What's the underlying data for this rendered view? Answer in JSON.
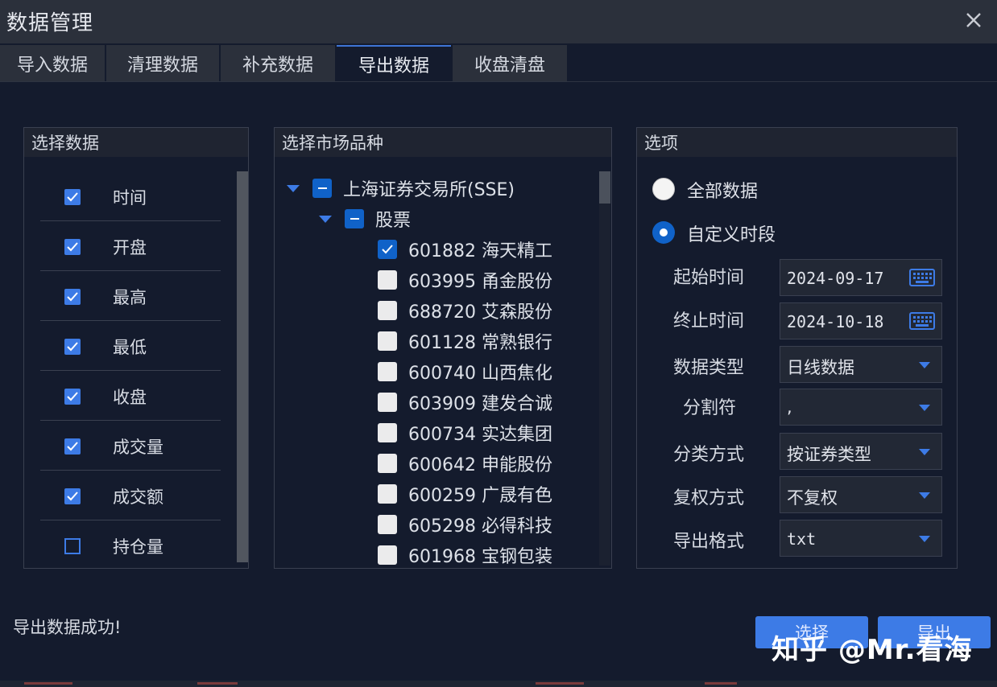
{
  "window": {
    "title": "数据管理"
  },
  "tabs": [
    {
      "label": "导入数据",
      "active": false
    },
    {
      "label": "清理数据",
      "active": false
    },
    {
      "label": "补充数据",
      "active": false
    },
    {
      "label": "导出数据",
      "active": true
    },
    {
      "label": "收盘清盘",
      "active": false
    }
  ],
  "data_panel": {
    "title": "选择数据",
    "fields": [
      {
        "label": "时间",
        "checked": true
      },
      {
        "label": "开盘",
        "checked": true
      },
      {
        "label": "最高",
        "checked": true
      },
      {
        "label": "最低",
        "checked": true
      },
      {
        "label": "收盘",
        "checked": true
      },
      {
        "label": "成交量",
        "checked": true
      },
      {
        "label": "成交额",
        "checked": true
      },
      {
        "label": "持仓量",
        "checked": false
      }
    ]
  },
  "market_panel": {
    "title": "选择市场品种",
    "exchange": "上海证券交易所(SSE)",
    "category": "股票",
    "stocks": [
      {
        "label": "601882 海天精工",
        "checked": true
      },
      {
        "label": "603995 甬金股份",
        "checked": false
      },
      {
        "label": "688720 艾森股份",
        "checked": false
      },
      {
        "label": "601128 常熟银行",
        "checked": false
      },
      {
        "label": "600740 山西焦化",
        "checked": false
      },
      {
        "label": "603909 建发合诚",
        "checked": false
      },
      {
        "label": "600734 实达集团",
        "checked": false
      },
      {
        "label": "600642 申能股份",
        "checked": false
      },
      {
        "label": "600259 广晟有色",
        "checked": false
      },
      {
        "label": "605298 必得科技",
        "checked": false
      },
      {
        "label": "601968 宝钢包装",
        "checked": false
      }
    ]
  },
  "options_panel": {
    "title": "选项",
    "radio_all": "全部数据",
    "radio_custom": "自定义时段",
    "selected_radio": "custom",
    "start_label": "起始时间",
    "start_value": "2024-09-17",
    "end_label": "终止时间",
    "end_value": "2024-10-18",
    "datatype_label": "数据类型",
    "datatype_value": "日线数据",
    "separator_label": "分割符",
    "separator_value": ",",
    "classify_label": "分类方式",
    "classify_value": "按证券类型",
    "adjust_label": "复权方式",
    "adjust_value": "不复权",
    "format_label": "导出格式",
    "format_value": "txt"
  },
  "status": "导出数据成功!",
  "buttons": {
    "select": "选择",
    "export": "导出"
  },
  "watermark": "知乎 @Mr.看海",
  "colors": {
    "accent": "#3d7be6",
    "background": "#141b2d",
    "titlebar": "#2b303b"
  }
}
